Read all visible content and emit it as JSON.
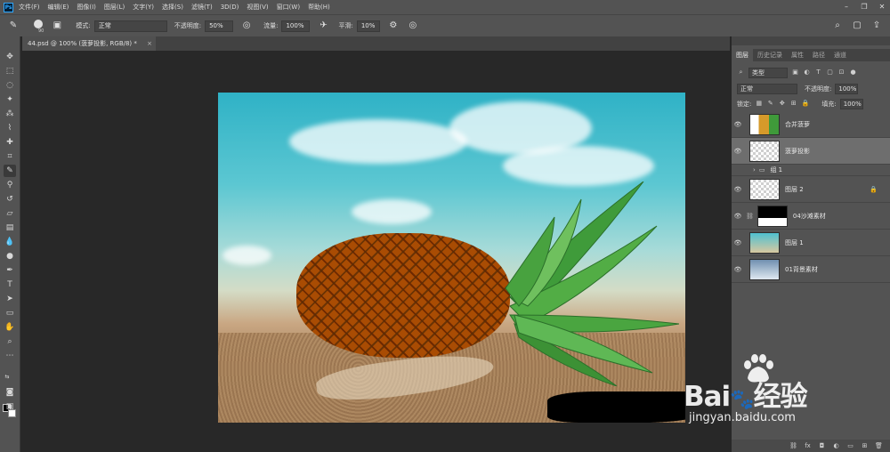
{
  "app": {
    "logo_text": "Ps"
  },
  "menu": [
    "文件(F)",
    "编辑(E)",
    "图像(I)",
    "图层(L)",
    "文字(Y)",
    "选择(S)",
    "滤镜(T)",
    "3D(D)",
    "视图(V)",
    "窗口(W)",
    "帮助(H)"
  ],
  "options": {
    "brush_size": "90",
    "mode_label": "模式:",
    "mode_value": "正常",
    "opacity_label": "不透明度:",
    "opacity_value": "50%",
    "flow_label": "流量:",
    "flow_value": "100%",
    "smooth_label": "平滑:",
    "smooth_value": "10%"
  },
  "document": {
    "tab_title": "44.psd @ 100% (菠萝投影, RGB/8) *",
    "close": "×"
  },
  "panel": {
    "tabs": [
      "图层",
      "历史记录",
      "属性",
      "路径",
      "通道"
    ],
    "kind_filter": "类型",
    "blend_mode": "正常",
    "opacity_label": "不透明度:",
    "opacity_value": "100%",
    "lock_label": "锁定:",
    "fill_label": "填充:",
    "fill_value": "100%"
  },
  "layers": [
    {
      "name": "合并菠萝",
      "thumb": "pine",
      "selected": false,
      "type": "layer"
    },
    {
      "name": "菠萝投影",
      "thumb": "transparent",
      "selected": true,
      "type": "layer"
    },
    {
      "name": "组 1",
      "thumb": "",
      "selected": false,
      "type": "group"
    },
    {
      "name": "图层 2",
      "thumb": "transparent",
      "selected": false,
      "type": "layer",
      "locked": true
    },
    {
      "name": "04沙滩素材",
      "thumb": "sand",
      "selected": false,
      "type": "masked"
    },
    {
      "name": "图层 1",
      "thumb": "sky",
      "selected": false,
      "type": "layer"
    },
    {
      "name": "01背景素材",
      "thumb": "bg",
      "selected": false,
      "type": "layer"
    }
  ],
  "watermark": {
    "brand": "Bai",
    "brand2": "经验",
    "url": "jingyan.baidu.com"
  }
}
